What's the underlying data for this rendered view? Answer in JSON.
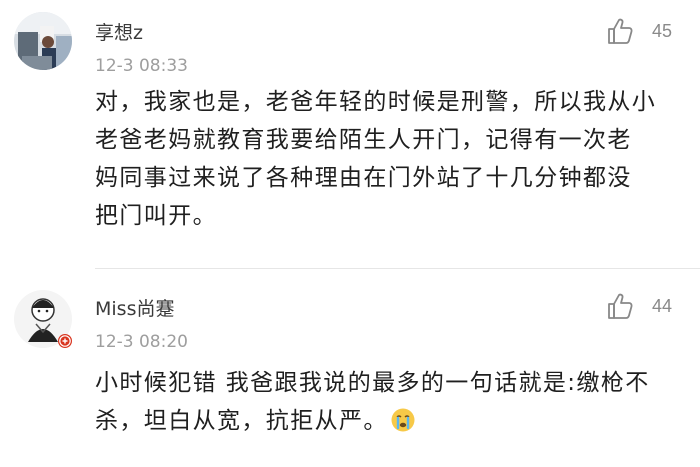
{
  "comments": [
    {
      "username": "享想z",
      "time": "12-3 08:33",
      "likes": "45",
      "avatar_icon": "user-photo-avatar",
      "text_lines": [
        "对，我家也是，老爸年轻的时候是刑警，所以我从小",
        "老爸老妈就教育我要给陌生人开门，记得有一次老",
        "妈同事过来说了各种理由在门外站了十几分钟都没",
        "把门叫开。"
      ]
    },
    {
      "username": "Miss尚蹇",
      "time": "12-3 08:20",
      "likes": "44",
      "avatar_icon": "user-cartoon-avatar",
      "badge_icon": "verified-badge-icon",
      "text_lines": [
        "小时候犯错 我爸跟我说的最多的一句话就是:缴枪不",
        "杀，坦白从宽，抗拒从严。"
      ],
      "emoji": "crying-face-emoji"
    }
  ],
  "colors": {
    "text": "#1f1f1f",
    "meta": "#9e9e9e",
    "divider": "#e6e6e6",
    "badge": "#d9351f"
  }
}
